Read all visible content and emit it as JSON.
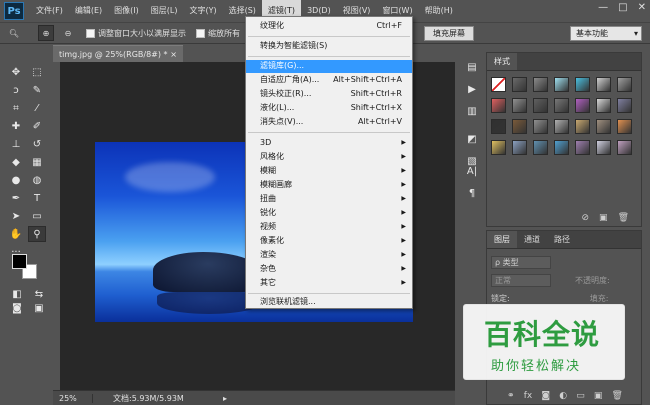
{
  "app": {
    "logo": "Ps"
  },
  "menubar": {
    "items": [
      {
        "label": "文件(F)"
      },
      {
        "label": "编辑(E)"
      },
      {
        "label": "图像(I)"
      },
      {
        "label": "图层(L)"
      },
      {
        "label": "文字(Y)"
      },
      {
        "label": "选择(S)"
      },
      {
        "label": "滤镜(T)"
      },
      {
        "label": "3D(D)"
      },
      {
        "label": "视图(V)"
      },
      {
        "label": "窗口(W)"
      },
      {
        "label": "帮助(H)"
      }
    ],
    "window_controls": {
      "minimize": "—",
      "restore": "□",
      "close": "✕"
    }
  },
  "options_bar": {
    "resize_windows_label": "调整窗口大小以满屏显示",
    "zoom_all_label": "缩放所有",
    "fill_screen_label": "填充屏幕",
    "workspace": "基本功能"
  },
  "document": {
    "tab_title": "timg.jpg @ 25%(RGB/8#) *",
    "close": "×",
    "status_zoom": "25%",
    "status_doc": "文档:5.93M/5.93M"
  },
  "filter_menu": {
    "items": [
      {
        "label": "纹理化",
        "shortcut": "Ctrl+F"
      },
      {
        "label": "转换为智能滤镜(S)",
        "shortcut": ""
      },
      {
        "label": "滤镜库(G)...",
        "shortcut": ""
      },
      {
        "label": "自适应广角(A)...",
        "shortcut": "Alt+Shift+Ctrl+A"
      },
      {
        "label": "镜头校正(R)...",
        "shortcut": "Shift+Ctrl+R"
      },
      {
        "label": "液化(L)...",
        "shortcut": "Shift+Ctrl+X"
      },
      {
        "label": "消失点(V)...",
        "shortcut": "Alt+Ctrl+V"
      },
      {
        "label": "3D"
      },
      {
        "label": "风格化"
      },
      {
        "label": "模糊"
      },
      {
        "label": "模糊画廊"
      },
      {
        "label": "扭曲"
      },
      {
        "label": "锐化"
      },
      {
        "label": "视频"
      },
      {
        "label": "像素化"
      },
      {
        "label": "渲染"
      },
      {
        "label": "杂色"
      },
      {
        "label": "其它"
      },
      {
        "label": "浏览联机滤镜..."
      }
    ]
  },
  "styles_panel": {
    "tab": "样式",
    "swatches": [
      "#e0e0e0",
      "#6a6a6a",
      "#8a8a8a",
      "#9fe0f0",
      "#4ac0e0",
      "#d0d0d0",
      "#a0a0a0",
      "#e06060",
      "#909090",
      "#606060",
      "#787878",
      "#b060c0",
      "#d8d8d8",
      "#8080a0",
      "#303030",
      "#7a5a3a",
      "#909090",
      "#b0b0b0",
      "#c8a870",
      "#a09080",
      "#e09050",
      "#e0c060",
      "#8aa0c0",
      "#6090b0",
      "#50a0d0",
      "#a080b0",
      "#d0d0e0",
      "#c0a0c0"
    ]
  },
  "layers_panel": {
    "tabs": [
      "图层",
      "通道",
      "路径"
    ],
    "kind_label": "ρ 类型",
    "blend_mode": "正常",
    "opacity_label": "不透明度:",
    "lock_label": "锁定:",
    "fill_label": "填充:"
  },
  "watermark": {
    "title": "百科全说",
    "subtitle": "助你轻松解决"
  }
}
